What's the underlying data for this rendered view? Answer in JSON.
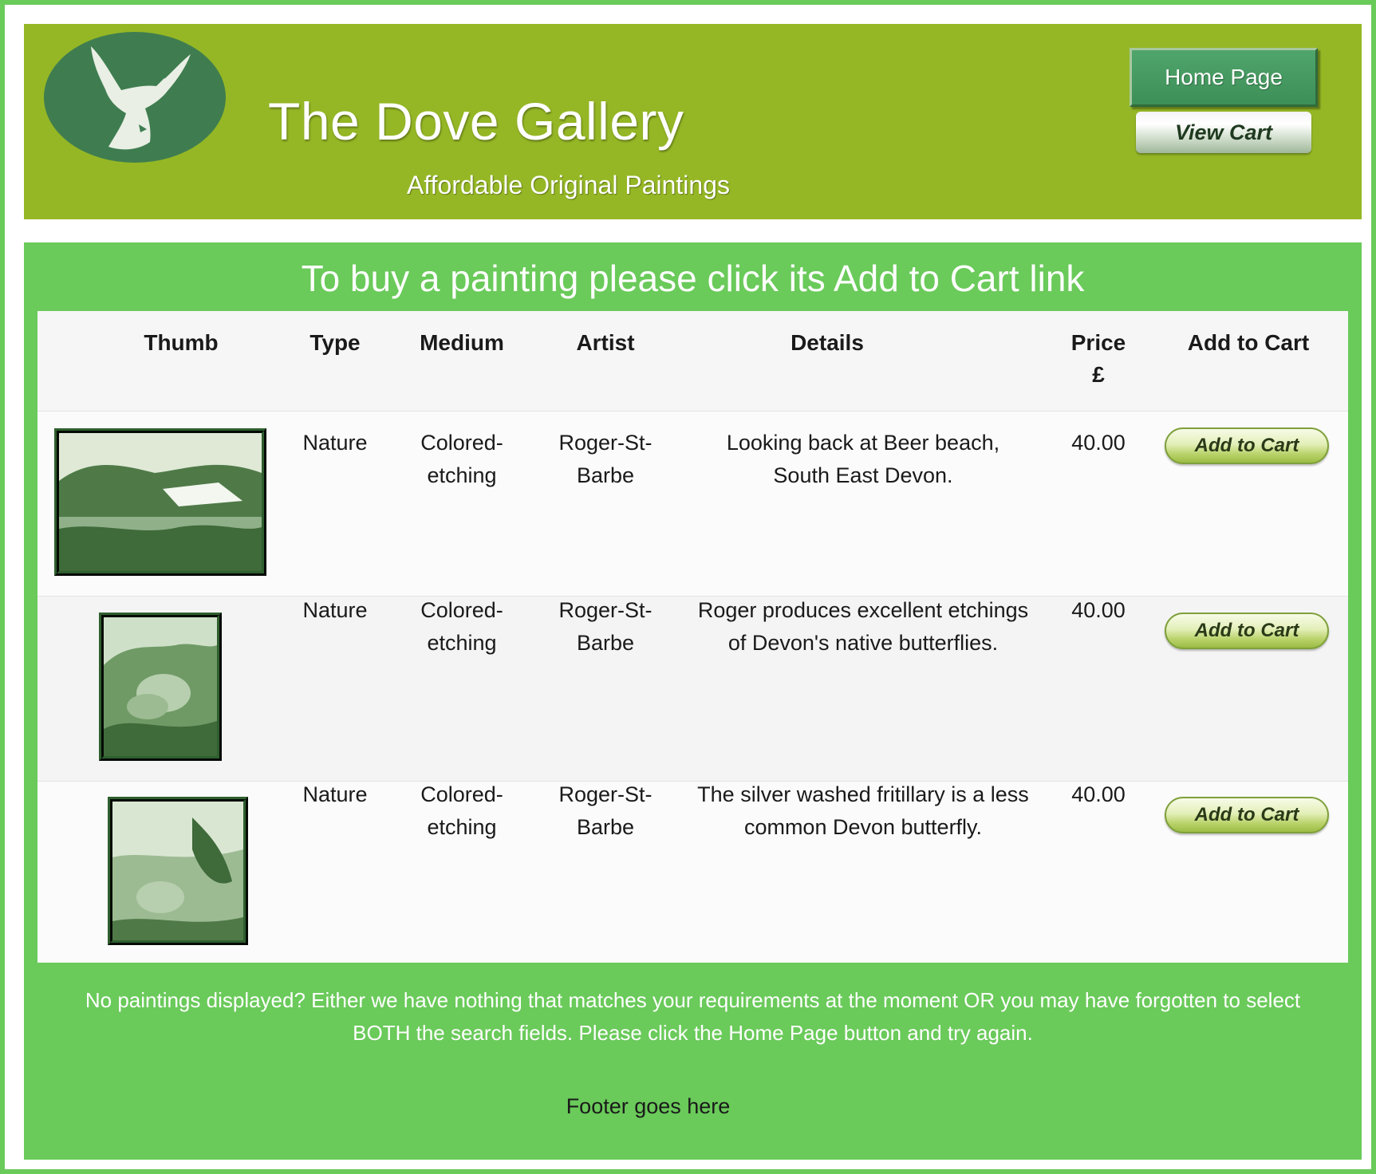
{
  "header": {
    "title": "The Dove Gallery",
    "tagline": "Affordable Original Paintings",
    "home_button": "Home Page",
    "cart_button": "View Cart",
    "logo_icon": "dove-icon"
  },
  "main": {
    "instruction": "To buy a painting please click its Add to Cart link",
    "columns": {
      "thumb": "Thumb",
      "type": "Type",
      "medium": "Medium",
      "artist": "Artist",
      "details": "Details",
      "price_line1": "Price",
      "price_line2": "£",
      "cart": "Add to Cart"
    },
    "rows": [
      {
        "type": "Nature",
        "medium_l1": "Colored-",
        "medium_l2": "etching",
        "artist_l1": "Roger-St-",
        "artist_l2": "Barbe",
        "details_l1": "Looking back at Beer beach,",
        "details_l2": "South East Devon.",
        "price": "40.00",
        "cart": "Add to Cart"
      },
      {
        "type": "Nature",
        "medium_l1": "Colored-",
        "medium_l2": "etching",
        "artist_l1": "Roger-St-",
        "artist_l2": "Barbe",
        "details_l1": "Roger produces excellent etchings",
        "details_l2": "of Devon's native butterflies.",
        "price": "40.00",
        "cart": "Add to Cart"
      },
      {
        "type": "Nature",
        "medium_l1": "Colored-",
        "medium_l2": "etching",
        "artist_l1": "Roger-St-",
        "artist_l2": "Barbe",
        "details_l1": "The silver washed fritillary is a less",
        "details_l2": "common Devon butterfly.",
        "price": "40.00",
        "cart": "Add to Cart"
      }
    ],
    "note_l1": "No paintings displayed? Either we have nothing that matches your requirements at the moment OR you may have forgotten to select",
    "note_l2": "BOTH the search fields. Please click the Home Page button and try again.",
    "footer": "Footer goes here"
  },
  "colors": {
    "header_bg": "#95b725",
    "main_bg": "#6aca5a",
    "table_bg": "#fbfbfb",
    "home_button_bg": "#3d8f58",
    "logo_bg": "#3f7d50"
  }
}
